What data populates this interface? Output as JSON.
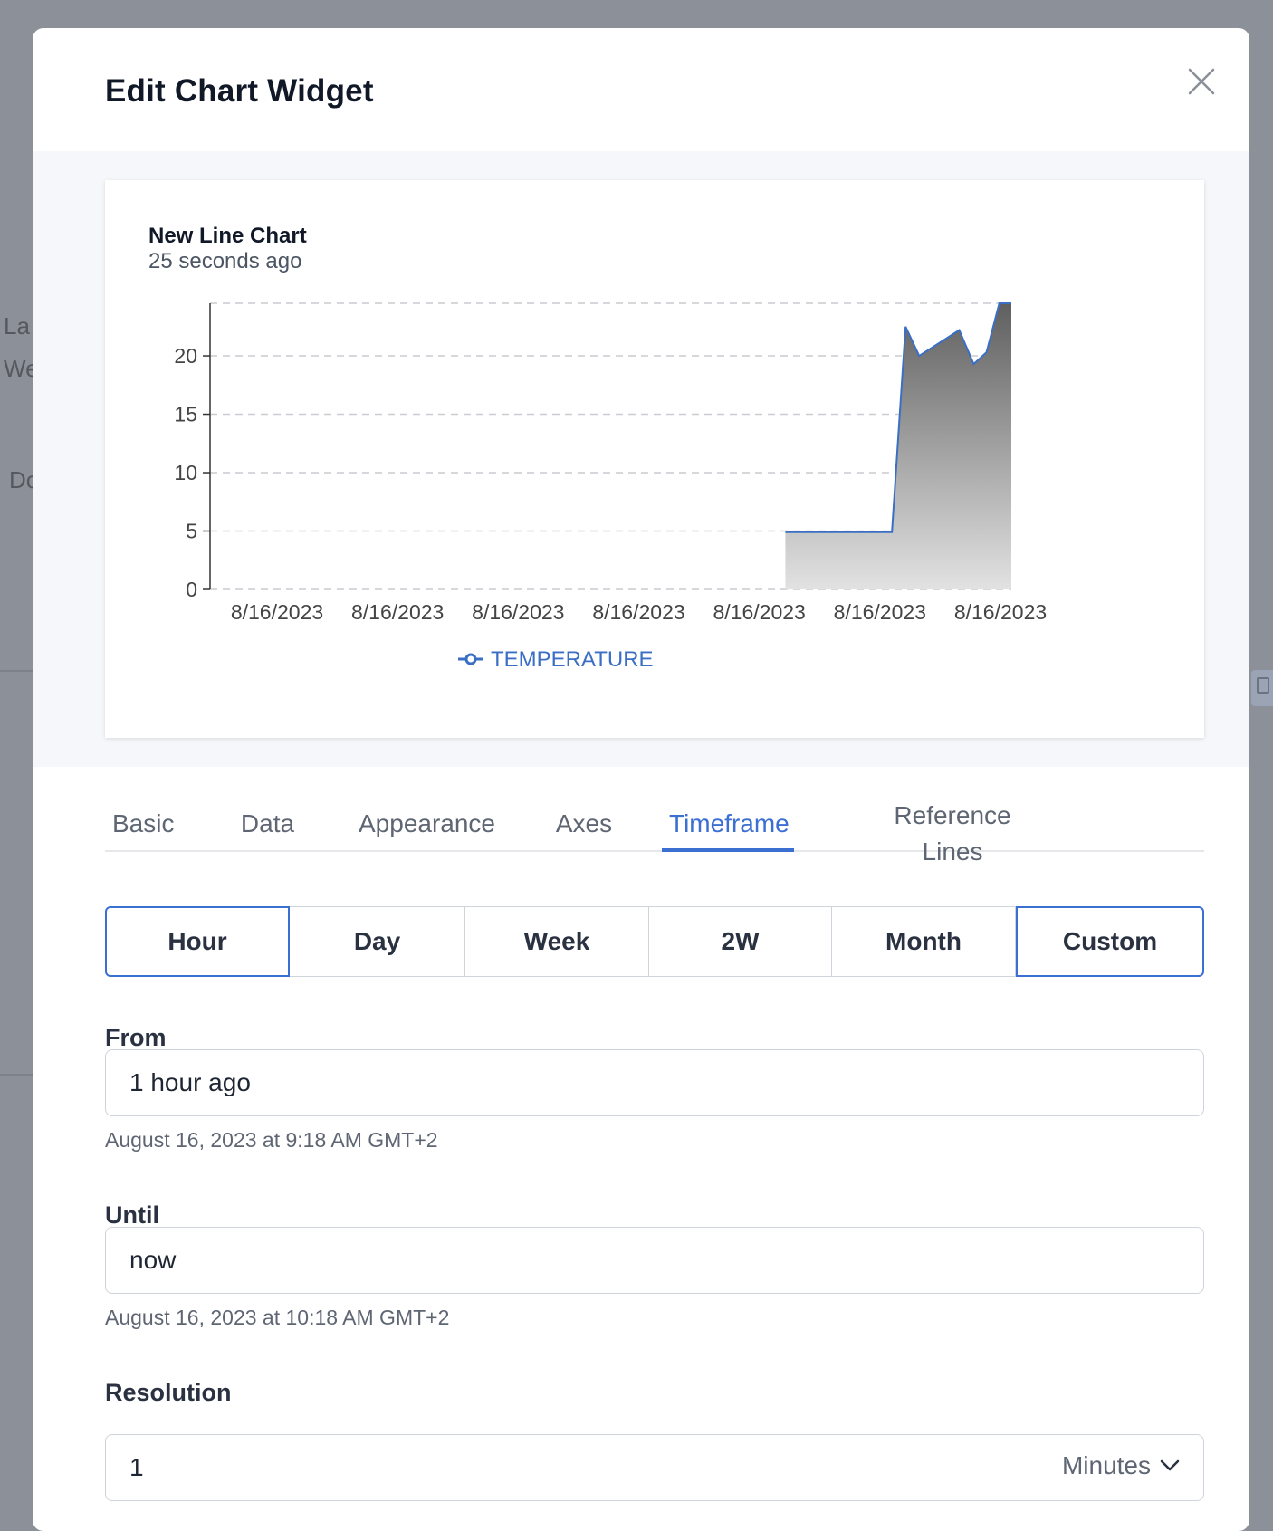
{
  "background": {
    "fragments": [
      "La",
      "We",
      "Do"
    ]
  },
  "modal": {
    "title": "Edit Chart Widget",
    "close_icon": "close-icon"
  },
  "preview": {
    "title": "New Line Chart",
    "subtitle": "25 seconds ago"
  },
  "chart_data": {
    "type": "area",
    "title": "New Line Chart",
    "subtitle": "25 seconds ago",
    "y_ticks": [
      0,
      5,
      10,
      15,
      20
    ],
    "ylim": [
      0,
      24.5
    ],
    "x_tick_labels": [
      "8/16/2023",
      "8/16/2023",
      "8/16/2023",
      "8/16/2023",
      "8/16/2023",
      "8/16/2023",
      "8/16/2023"
    ],
    "x_range": [
      0,
      1
    ],
    "grid": true,
    "legend": "bottom-center",
    "series": [
      {
        "name": "TEMPERATURE",
        "color": "#3b6fc4",
        "x": [
          0.718,
          0.851,
          0.868,
          0.885,
          0.935,
          0.953,
          0.969,
          0.985,
          1.0
        ],
        "y": [
          4.9,
          4.9,
          22.5,
          20.0,
          22.2,
          19.3,
          20.3,
          24.5,
          24.5
        ]
      }
    ]
  },
  "tabs": [
    {
      "label": "Basic"
    },
    {
      "label": "Data"
    },
    {
      "label": "Appearance"
    },
    {
      "label": "Axes"
    },
    {
      "label": "Timeframe",
      "active": true
    },
    {
      "label": "Reference Lines"
    }
  ],
  "range_buttons": [
    {
      "label": "Hour",
      "selected": true
    },
    {
      "label": "Day"
    },
    {
      "label": "Week"
    },
    {
      "label": "2W"
    },
    {
      "label": "Month"
    },
    {
      "label": "Custom",
      "selected": true
    }
  ],
  "from": {
    "label": "From",
    "value": "1 hour ago",
    "help": "August 16, 2023 at 9:18 AM GMT+2"
  },
  "until": {
    "label": "Until",
    "value": "now",
    "help": "August 16, 2023 at 10:18 AM GMT+2"
  },
  "resolution": {
    "label": "Resolution",
    "value": "1",
    "unit": "Minutes",
    "unit_icon": "chevron-down-icon"
  },
  "colors": {
    "accent": "#3b6fd1",
    "overlay": "#8c9098"
  }
}
